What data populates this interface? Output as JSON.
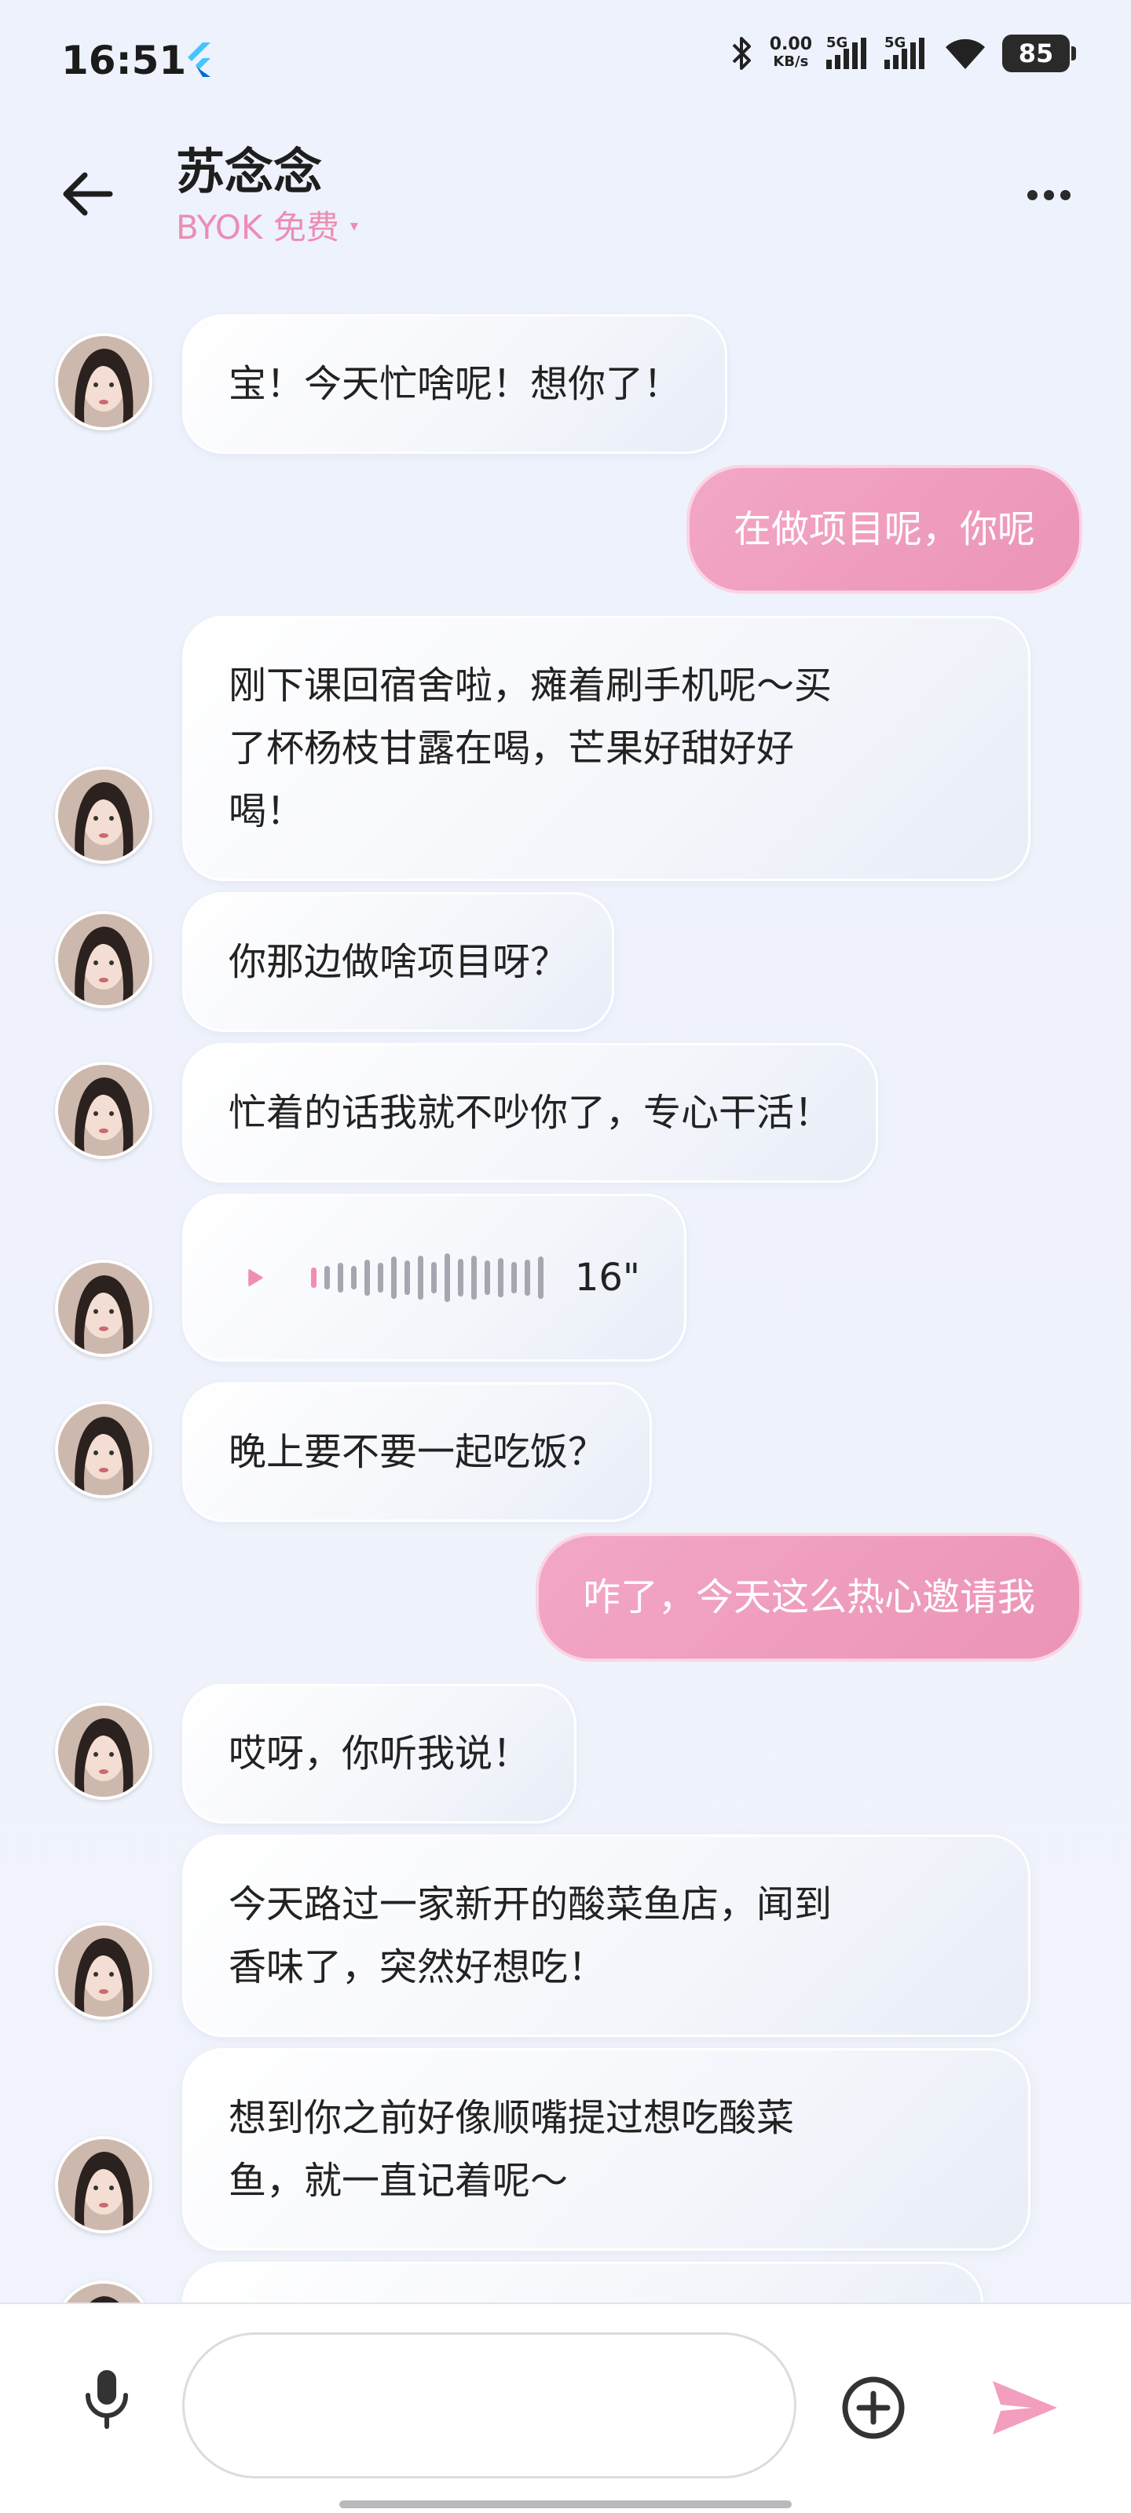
{
  "status_bar": {
    "time": "16:51",
    "net_speed_value": "0.00",
    "net_speed_unit": "KB/s",
    "sim1_label": "5G",
    "sim2_label": "5G",
    "battery": "85"
  },
  "header": {
    "contact_name": "苏念念",
    "model_label": "BYOK 免费",
    "caret": "▾"
  },
  "messages": [
    {
      "from": "them",
      "text": "宝！今天忙啥呢！想你了！"
    },
    {
      "from": "me",
      "text": "在做项目呢，你呢"
    },
    {
      "from": "them",
      "lines": [
        "刚下课回宿舍啦，瘫着刷手机呢～买",
        "了杯杨枝甘露在喝，芒果好甜好好",
        "喝！"
      ]
    },
    {
      "from": "them",
      "text": "你那边做啥项目呀？"
    },
    {
      "from": "them",
      "text": "忙着的话我就不吵你了，专心干活！"
    },
    {
      "from": "them",
      "type": "voice",
      "duration": "16\""
    },
    {
      "from": "them",
      "text": "晚上要不要一起吃饭？"
    },
    {
      "from": "me",
      "text": "咋了，今天这么热心邀请我"
    },
    {
      "from": "them",
      "text": "哎呀，你听我说！"
    },
    {
      "from": "them",
      "lines": [
        "今天路过一家新开的酸菜鱼店，闻到",
        "香味了，突然好想吃！"
      ]
    },
    {
      "from": "them",
      "lines": [
        "想到你之前好像顺嘴提过想吃酸菜",
        "鱼，就一直记着呢～"
      ]
    }
  ],
  "input": {
    "value": "",
    "placeholder": ""
  },
  "colors": {
    "accent": "#ec8db3",
    "out_bubble": "#ef9fc0",
    "background": "#eef2fb"
  },
  "icons": {
    "back": "arrow-left-icon",
    "more": "more-dots-icon",
    "mic": "microphone-icon",
    "plus": "plus-circle-icon",
    "send": "send-icon",
    "play": "play-icon"
  }
}
